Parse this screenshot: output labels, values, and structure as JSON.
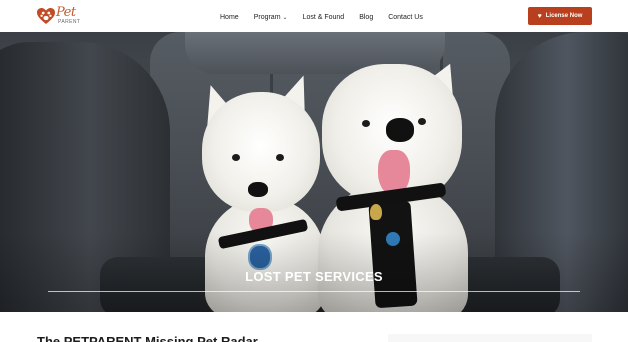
{
  "brand": {
    "logo_text": "Pet",
    "logo_sub": "PARENT",
    "accent_color": "#b8401f"
  },
  "nav": {
    "items": [
      {
        "label": "Home"
      },
      {
        "label": "Program",
        "has_dropdown": true
      },
      {
        "label": "Lost & Found"
      },
      {
        "label": "Blog"
      },
      {
        "label": "Contact Us"
      }
    ]
  },
  "header": {
    "cta_label": "License Now",
    "cta_icon": "heart-icon"
  },
  "hero": {
    "title": "LOST PET SERVICES"
  },
  "content": {
    "heading": "The PETPARENT Missing Pet Radar"
  }
}
